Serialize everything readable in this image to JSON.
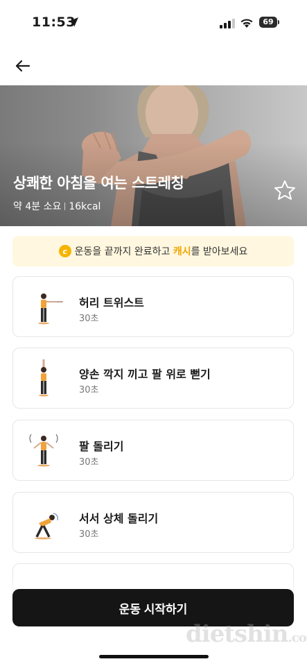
{
  "status_bar": {
    "time": "11:53",
    "battery": "69"
  },
  "hero": {
    "title": "상쾌한 아침을 여는 스트레칭",
    "duration": "약 4분 소요",
    "calories": "16kcal"
  },
  "banner": {
    "coin_glyph": "c",
    "text_before": "운동을 끝까지 완료하고 ",
    "highlight": "캐시",
    "text_after": "를 받아보세요"
  },
  "exercises": [
    {
      "name": "허리 트위스트",
      "duration": "30초"
    },
    {
      "name": "양손 깍지 끼고 팔 위로 뻗기",
      "duration": "30초"
    },
    {
      "name": "팔 돌리기",
      "duration": "30초"
    },
    {
      "name": "서서 상체 돌리기",
      "duration": "30초"
    }
  ],
  "start_button": {
    "label": "운동 시작하기"
  },
  "watermark": {
    "text": "dietshin",
    "suffix": ".com"
  },
  "colors": {
    "accent": "#f0a500",
    "banner_bg": "#fff7df",
    "button_bg": "#151515"
  }
}
